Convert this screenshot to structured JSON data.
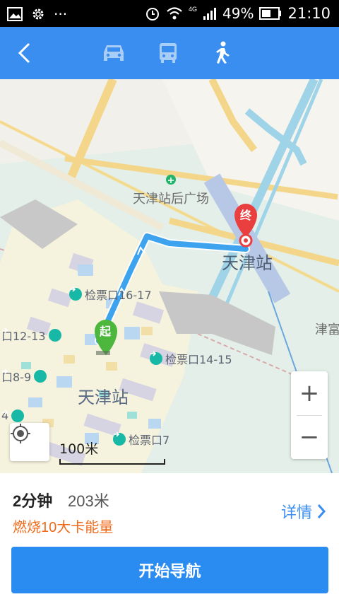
{
  "status_bar": {
    "battery_percent": "49%",
    "network": "4G",
    "time": "21:10",
    "more": "···"
  },
  "top_bar": {
    "modes": [
      "drive",
      "bus",
      "walk"
    ],
    "active_mode": "walk"
  },
  "map": {
    "labels": {
      "plaza": "天津站后广场",
      "station_top": "天津站",
      "station_main": "天津站",
      "right_edge": "津富"
    },
    "gates": {
      "g16_17": "检票口16-17",
      "g12_13": "口12-13",
      "g8_9": "口8-9",
      "g14_15": "检票口14-15",
      "g7": "检票口7",
      "g4": "4"
    },
    "start_marker": "起",
    "end_marker": "终",
    "scale": "100米",
    "zoom_in": "+",
    "zoom_out": "−"
  },
  "route": {
    "duration": "2分钟",
    "distance": "203米",
    "calories": "燃烧10大卡能量",
    "detail": "详情",
    "start_button": "开始导航"
  },
  "colors": {
    "accent": "#3a8ef0",
    "calories": "#f06a1a",
    "route_line": "#3ea3ef",
    "start_pin": "#4cb63d",
    "end_pin": "#ea3f3f"
  }
}
